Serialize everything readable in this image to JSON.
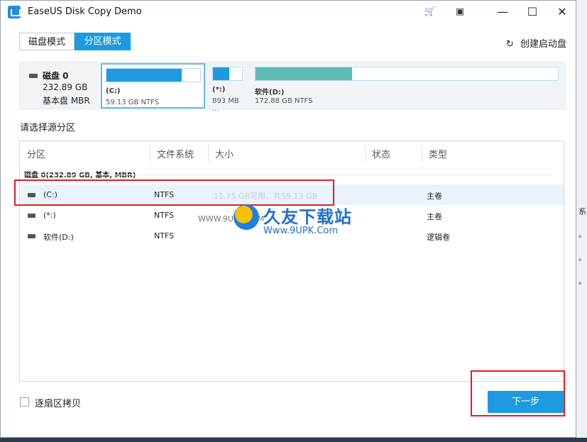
{
  "window": {
    "title": "EaseUS Disk Copy Demo",
    "controls": {
      "minimize": "—",
      "maximize": "☐",
      "close": "✕"
    }
  },
  "tabs": [
    {
      "label": "磁盘模式",
      "active": false
    },
    {
      "label": "分区模式",
      "active": true
    }
  ],
  "create_boot_label": "创建启动盘",
  "disk": {
    "name": "磁盘 0",
    "size": "232.89 GB",
    "type": "基本盘 MBR",
    "partitions": [
      {
        "label": "(C:)",
        "detail": "59.13 GB NTFS",
        "used_fraction": 0.8
      },
      {
        "label": "(*:)",
        "detail": "893 MB ...",
        "used_fraction": 0.55
      },
      {
        "label": "软件(D:)",
        "detail": "172.88 GB NTFS",
        "used_fraction": 0.32
      }
    ]
  },
  "select_source_label": "请选择源分区",
  "table": {
    "headers": [
      "分区",
      "文件系统",
      "大小",
      "状态",
      "类型"
    ],
    "group_label": "磁盘 0(232.89 GB, 基本, MBR)",
    "rows": [
      {
        "name": "(C:)",
        "fs": "NTFS",
        "size": "11.75 GB可用，共59.13 GB",
        "status": "",
        "type": "主卷"
      },
      {
        "name": "(*:)",
        "fs": "NTFS",
        "size": "",
        "status": "",
        "type": "主卷"
      },
      {
        "name": "软件(D:)",
        "fs": "NTFS",
        "size": "",
        "status": "",
        "type": "逻辑卷"
      }
    ]
  },
  "sector_copy_label": "逐扇区拷贝",
  "next_button_label": "下一步",
  "watermark": {
    "title": "久友下载站",
    "url": "Www.9UPK.Com",
    "left_text": "WWW.9UPK.COM"
  },
  "right_edge_texts": [
    "系",
    "。",
    "。",
    "。"
  ],
  "colors": {
    "accent": "#1e9be0",
    "highlight_box": "#e02020",
    "selected_row": "#e8f3fb"
  }
}
